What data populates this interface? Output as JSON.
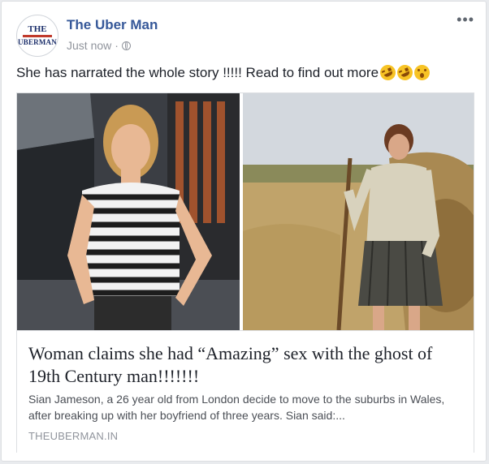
{
  "post": {
    "page_name": "The Uber Man",
    "avatar_line1": "THE",
    "avatar_line2": "UBERMAN",
    "timestamp": "Just now",
    "separator": "·",
    "audience_icon": "globe-icon",
    "more_label": "•••",
    "text": "She has narrated the whole story !!!!! Read to find out more",
    "emojis": [
      "rofl-emoji",
      "rofl-emoji",
      "astonished-emoji"
    ]
  },
  "link": {
    "headline": "Woman claims she had “Amazing” sex with the ghost of 19th Century man!!!!!!!",
    "description": "Sian Jameson, a 26 year old from London decide to move to the suburbs in Wales, after breaking up with her boyfriend of three years. Sian said:...",
    "domain": "THEUBERMAN.IN"
  },
  "colors": {
    "page_name": "#365899",
    "meta": "#90949c",
    "text": "#1d2129",
    "background": "#e9ebee"
  }
}
